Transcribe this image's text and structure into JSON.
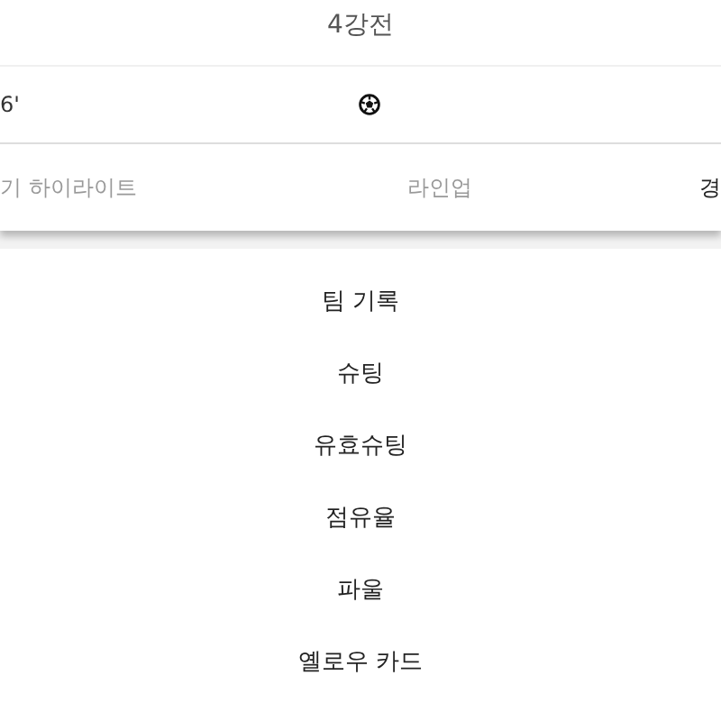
{
  "header": {
    "title": "4강전"
  },
  "event": {
    "minute": "6'"
  },
  "tabs": [
    {
      "label": "기 하이라이트",
      "selected": false
    },
    {
      "label": "라인업",
      "selected": false
    },
    {
      "label": "경",
      "selected": true
    }
  ],
  "stats": {
    "title": "팀 기록",
    "rows": [
      "슈팅",
      "유효슈팅",
      "점유율",
      "파울",
      "옐로우 카드"
    ]
  }
}
